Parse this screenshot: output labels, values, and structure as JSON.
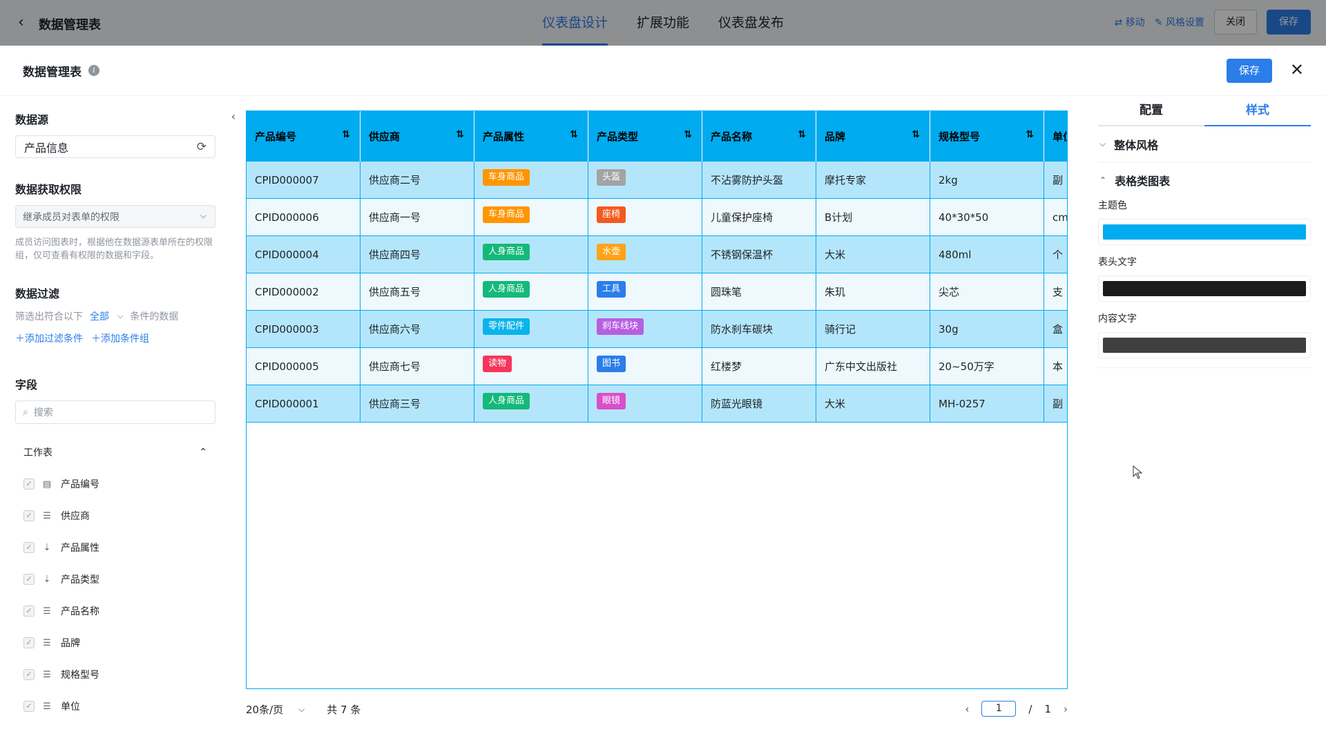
{
  "topbar": {
    "title": "数据管理表",
    "tabs": [
      "仪表盘设计",
      "扩展功能",
      "仪表盘发布"
    ],
    "move_label": "移动",
    "style_settings_label": "风格设置",
    "close_label": "关闭",
    "save_label": "保存"
  },
  "modal": {
    "title": "数据管理表",
    "save_label": "保存"
  },
  "left": {
    "datasource_title": "数据源",
    "datasource_value": "产品信息",
    "permission_title": "数据获取权限",
    "permission_value": "继承成员对表单的权限",
    "permission_hint": "成员访问图表时，根据他在数据源表单所在的权限组，仅可查看有权限的数据和字段。",
    "filter_title": "数据过滤",
    "filter_prefix": "筛选出符合以下",
    "filter_mode": "全部",
    "filter_suffix": "条件的数据",
    "add_filter_label": "添加过滤条件",
    "add_group_label": "添加条件组",
    "fields_title": "字段",
    "search_placeholder": "搜索",
    "sheet_label": "工作表",
    "fields": [
      {
        "label": "产品编号",
        "icon": "serial-number-icon"
      },
      {
        "label": "供应商",
        "icon": "text-lines-icon"
      },
      {
        "label": "产品属性",
        "icon": "option-list-icon"
      },
      {
        "label": "产品类型",
        "icon": "option-list-icon"
      },
      {
        "label": "产品名称",
        "icon": "text-lines-icon"
      },
      {
        "label": "品牌",
        "icon": "text-lines-icon"
      },
      {
        "label": "规格型号",
        "icon": "text-lines-icon"
      },
      {
        "label": "单位",
        "icon": "text-lines-icon"
      }
    ]
  },
  "table": {
    "columns": [
      "产品编号",
      "供应商",
      "产品属性",
      "产品类型",
      "产品名称",
      "品牌",
      "规格型号",
      "单位"
    ],
    "rows": [
      {
        "id": "CPID000007",
        "supplier": "供应商二号",
        "attr": {
          "text": "车身商品",
          "color": "#ff9500"
        },
        "type": {
          "text": "头盔",
          "color": "#a3a3a3"
        },
        "name": "不沾雾防护头盔",
        "brand": "摩托专家",
        "spec": "2kg",
        "unit": "副"
      },
      {
        "id": "CPID000006",
        "supplier": "供应商一号",
        "attr": {
          "text": "车身商品",
          "color": "#ff9500"
        },
        "type": {
          "text": "座椅",
          "color": "#f25a1d"
        },
        "name": "儿童保护座椅",
        "brand": "B计划",
        "spec": "40*30*50",
        "unit": "cm"
      },
      {
        "id": "CPID000004",
        "supplier": "供应商四号",
        "attr": {
          "text": "人身商品",
          "color": "#14b97a"
        },
        "type": {
          "text": "水壶",
          "color": "#ffa31a"
        },
        "name": "不锈钢保温杯",
        "brand": "大米",
        "spec": "480ml",
        "unit": "个"
      },
      {
        "id": "CPID000002",
        "supplier": "供应商五号",
        "attr": {
          "text": "人身商品",
          "color": "#14b97a"
        },
        "type": {
          "text": "工具",
          "color": "#2b7de9"
        },
        "name": "圆珠笔",
        "brand": "朱玑",
        "spec": "尖芯",
        "unit": "支"
      },
      {
        "id": "CPID000003",
        "supplier": "供应商六号",
        "attr": {
          "text": "零件配件",
          "color": "#0ab4ea"
        },
        "type": {
          "text": "刹车线块",
          "color": "#b65fe0"
        },
        "name": "防水刹车碳块",
        "brand": "骑行记",
        "spec": "30g",
        "unit": "盒"
      },
      {
        "id": "CPID000005",
        "supplier": "供应商七号",
        "attr": {
          "text": "读物",
          "color": "#f5365c"
        },
        "type": {
          "text": "图书",
          "color": "#2b7de9"
        },
        "name": "红楼梦",
        "brand": "广东中文出版社",
        "spec": "20~50万字",
        "unit": "本"
      },
      {
        "id": "CPID000001",
        "supplier": "供应商三号",
        "attr": {
          "text": "人身商品",
          "color": "#14b97a"
        },
        "type": {
          "text": "眼镜",
          "color": "#d94fc9"
        },
        "name": "防蓝光眼镜",
        "brand": "大米",
        "spec": "MH-0257",
        "unit": "副"
      }
    ]
  },
  "pagination": {
    "page_size": "20条/页",
    "total": "共 7 条",
    "current": "1",
    "separator": "/",
    "pages": "1"
  },
  "right": {
    "tabs": [
      "配置",
      "样式"
    ],
    "overall_style": "整体风格",
    "table_chart": "表格类图表",
    "theme_color_label": "主题色",
    "theme_color": "#00abf0",
    "header_text_label": "表头文字",
    "header_text_color": "#1b1b1b",
    "content_text_label": "内容文字",
    "content_text_color": "#3f3f3f"
  }
}
